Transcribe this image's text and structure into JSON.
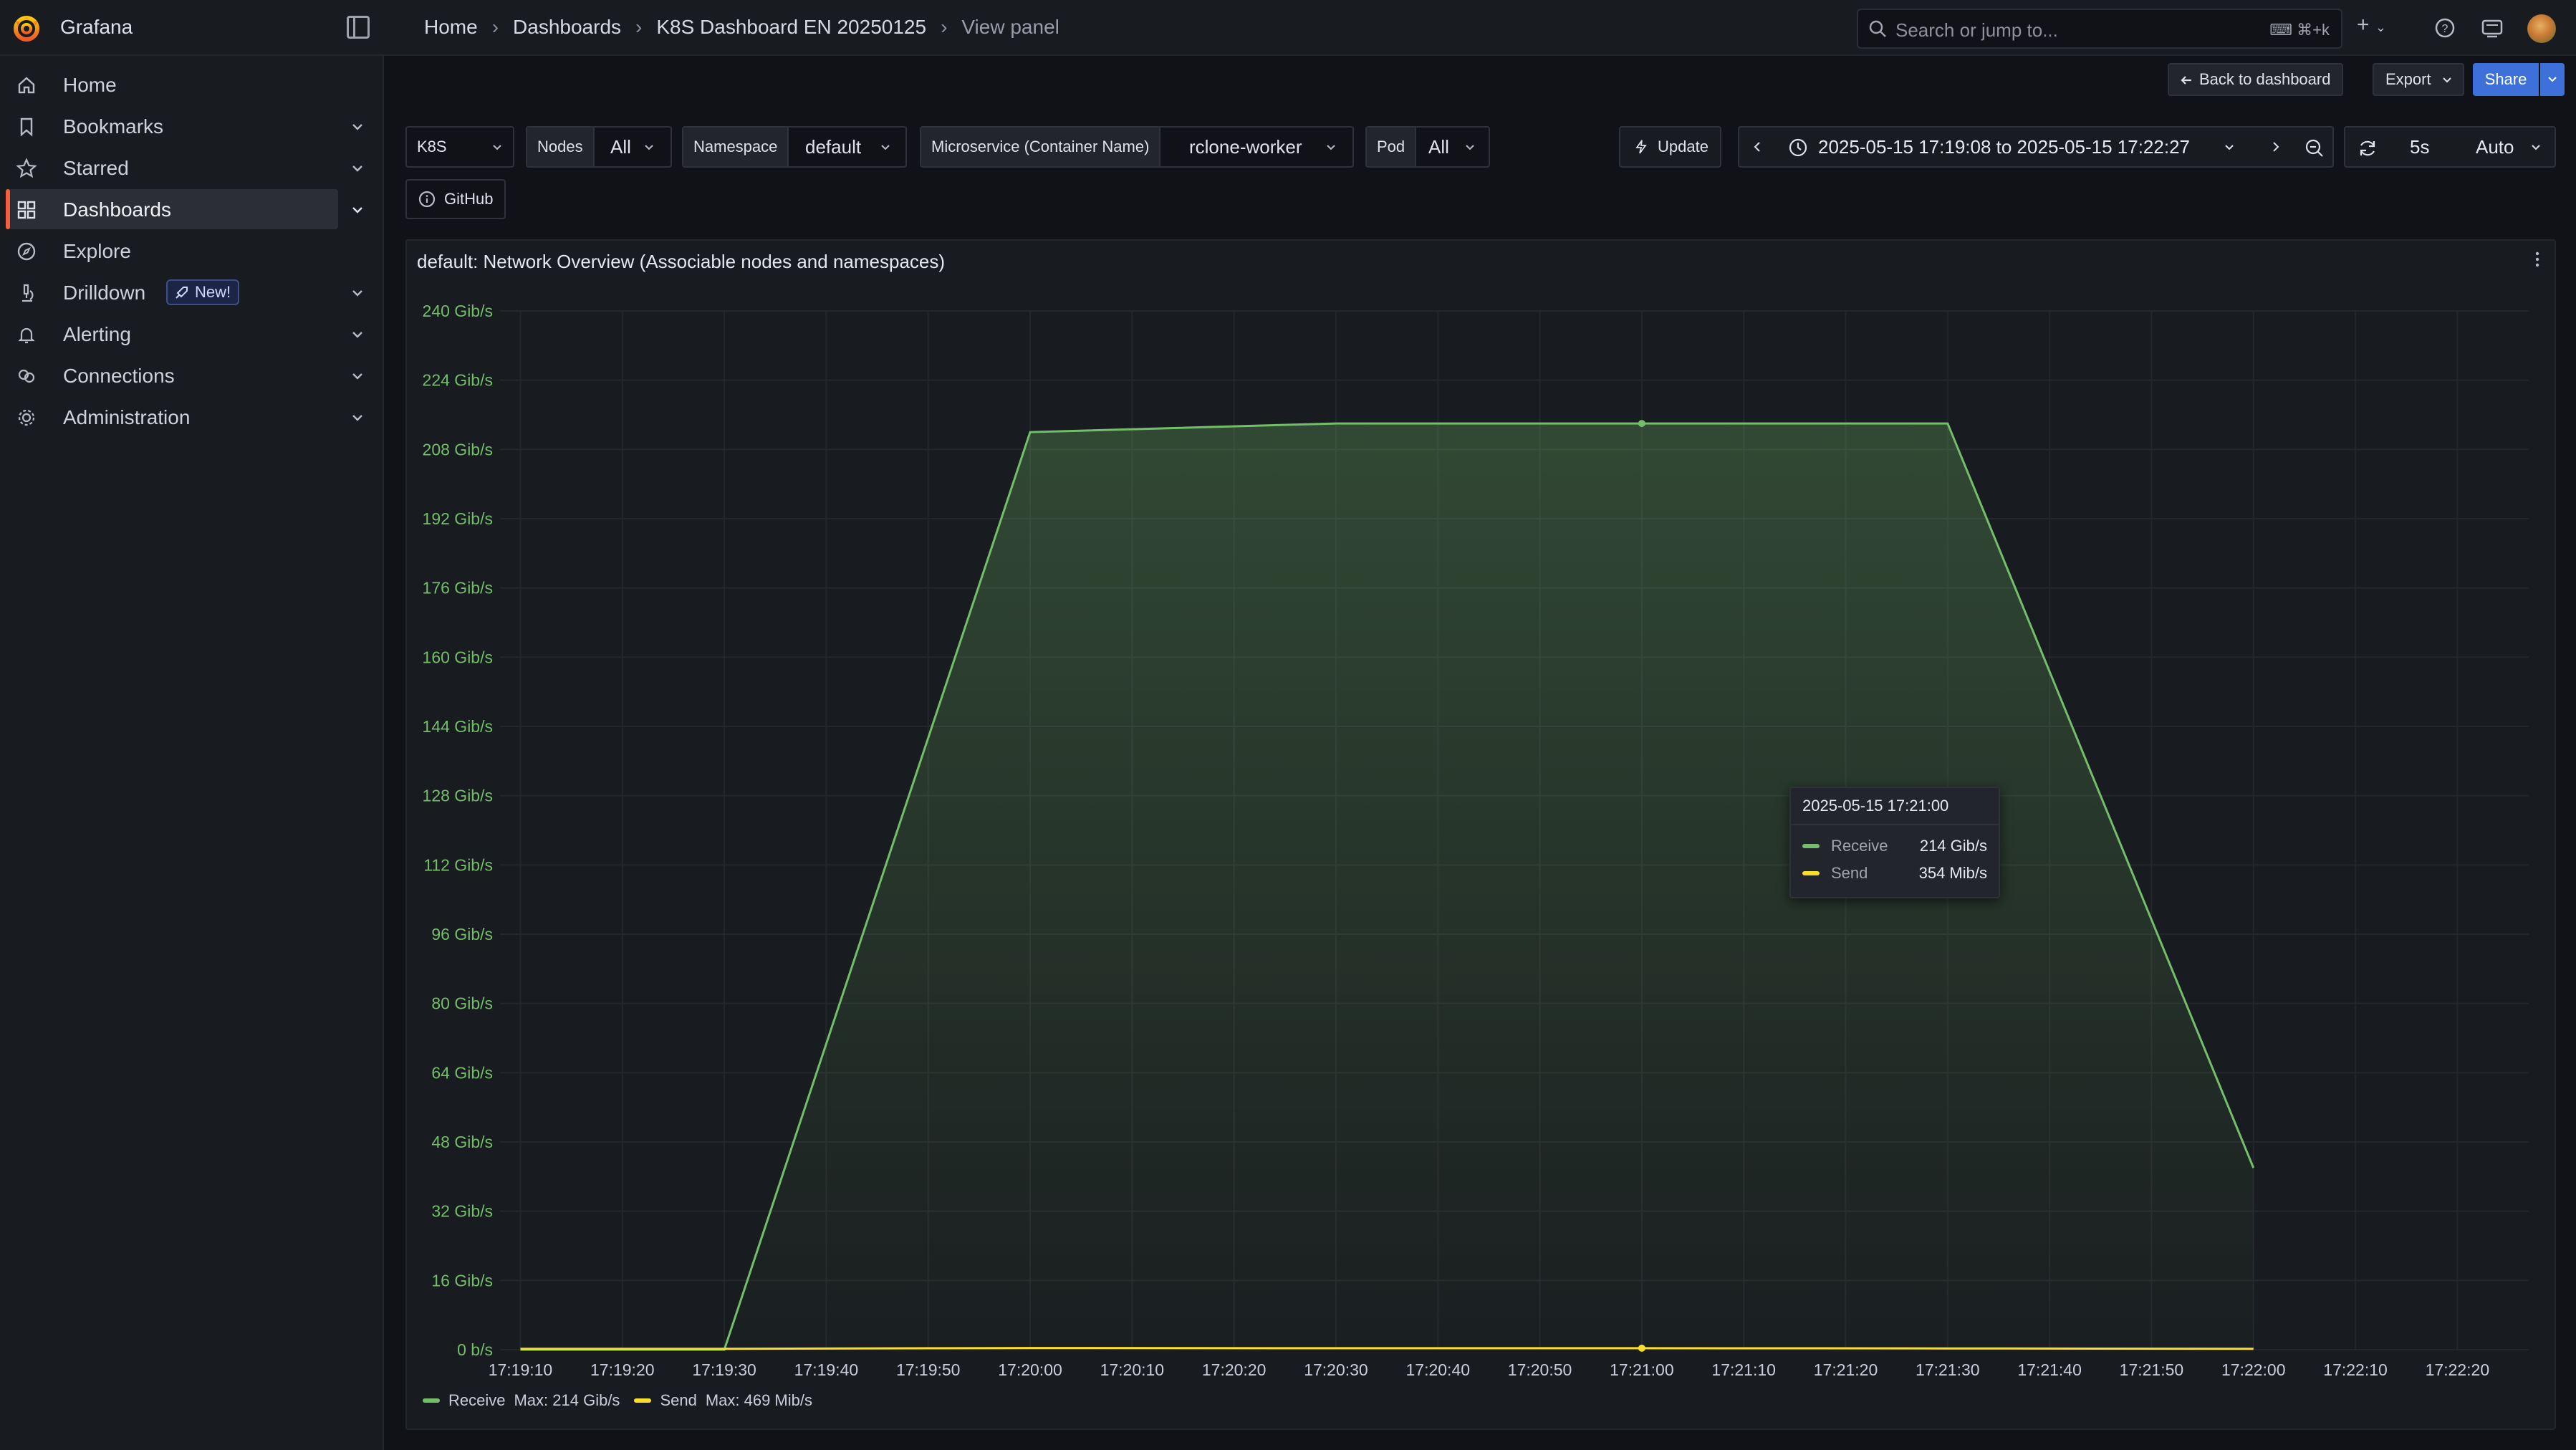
{
  "app": {
    "name": "Grafana"
  },
  "breadcrumb": [
    "Home",
    "Dashboards",
    "K8S Dashboard EN 20250125",
    "View panel"
  ],
  "search": {
    "placeholder": "Search or jump to...",
    "shortcut": "⌘+k"
  },
  "sidebar": {
    "items": [
      {
        "label": "Home",
        "icon": "home-icon",
        "expandable": false
      },
      {
        "label": "Bookmarks",
        "icon": "bookmark-icon",
        "expandable": true
      },
      {
        "label": "Starred",
        "icon": "star-icon",
        "expandable": true
      },
      {
        "label": "Dashboards",
        "icon": "apps-icon",
        "expandable": true,
        "active": true
      },
      {
        "label": "Explore",
        "icon": "compass-icon",
        "expandable": false
      },
      {
        "label": "Drilldown",
        "icon": "microscope-icon",
        "expandable": true,
        "badge": "New!"
      },
      {
        "label": "Alerting",
        "icon": "bell-icon",
        "expandable": true
      },
      {
        "label": "Connections",
        "icon": "link-icon",
        "expandable": true
      },
      {
        "label": "Administration",
        "icon": "cog-icon",
        "expandable": true
      }
    ]
  },
  "toolbar": {
    "back_label": "Back to dashboard",
    "export_label": "Export",
    "share_label": "Share"
  },
  "variables": {
    "datasource": "K8S",
    "nodes": {
      "label": "Nodes",
      "value": "All"
    },
    "namespace": {
      "label": "Namespace",
      "value": "default"
    },
    "microservice": {
      "label": "Microservice (Container Name)",
      "value": "rclone-worker"
    },
    "pod": {
      "label": "Pod",
      "value": "All"
    },
    "github_label": "GitHub"
  },
  "time": {
    "update_label": "Update",
    "range": "2025-05-15 17:19:08 to 2025-05-15 17:22:27",
    "refresh_interval": "5s",
    "refresh_mode": "Auto"
  },
  "colors": {
    "receive": "#73bf69",
    "send": "#fade2a",
    "accent": "#f55f3e",
    "primary": "#3d71d9"
  },
  "panel": {
    "title": "default:  Network Overview  (Associable nodes and namespaces)",
    "tooltip": {
      "time": "2025-05-15 17:21:00",
      "rows": [
        {
          "name": "Receive",
          "value": "214 Gib/s"
        },
        {
          "name": "Send",
          "value": "354 Mib/s"
        }
      ]
    },
    "legend": [
      {
        "name": "Receive",
        "max": "Max: 214 Gib/s"
      },
      {
        "name": "Send",
        "max": "Max: 469 Mib/s"
      }
    ]
  },
  "chart_data": {
    "type": "area",
    "x_ticks": [
      "17:19:10",
      "17:19:20",
      "17:19:30",
      "17:19:40",
      "17:19:50",
      "17:20:00",
      "17:20:10",
      "17:20:20",
      "17:20:30",
      "17:20:40",
      "17:20:50",
      "17:21:00",
      "17:21:10",
      "17:21:20",
      "17:21:30",
      "17:21:40",
      "17:21:50",
      "17:22:00",
      "17:22:10",
      "17:22:20"
    ],
    "y_ticks": [
      "0 b/s",
      "16 Gib/s",
      "32 Gib/s",
      "48 Gib/s",
      "64 Gib/s",
      "80 Gib/s",
      "96 Gib/s",
      "112 Gib/s",
      "128 Gib/s",
      "144 Gib/s",
      "160 Gib/s",
      "176 Gib/s",
      "192 Gib/s",
      "208 Gib/s",
      "224 Gib/s",
      "240 Gib/s"
    ],
    "ylim": [
      0,
      240
    ],
    "y_unit": "Gib/s",
    "grid": true,
    "legend_position": "bottom-left",
    "series": [
      {
        "name": "Receive",
        "x": [
          "17:19:10",
          "17:19:30",
          "17:20:00",
          "17:20:30",
          "17:21:00",
          "17:21:30",
          "17:22:00"
        ],
        "values": [
          0,
          0,
          212,
          214,
          214,
          214,
          42
        ]
      },
      {
        "name": "Send",
        "x": [
          "17:19:10",
          "17:19:30",
          "17:20:00",
          "17:20:30",
          "17:21:00",
          "17:21:30",
          "17:22:00"
        ],
        "values": [
          0.2,
          0.2,
          0.4,
          0.35,
          0.35,
          0.3,
          0.2
        ]
      }
    ]
  }
}
